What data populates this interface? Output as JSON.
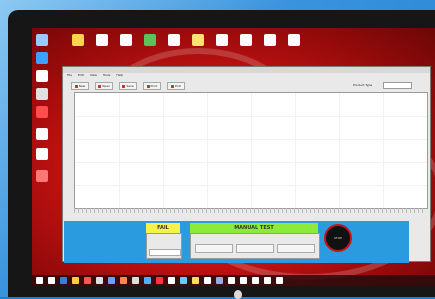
{
  "window": {
    "title": "",
    "menu": [
      "File",
      "Edit",
      "View",
      "Tools",
      "Help"
    ],
    "toolbar_buttons": [
      "New",
      "Open",
      "Save",
      "Print",
      "Exit"
    ],
    "product_label": "Product Type",
    "product_value": ""
  },
  "panel": {
    "status_text": "FAIL",
    "aux_label": "",
    "mode_title": "MANUAL TEST",
    "mode_buttons": [
      "",
      "",
      ""
    ],
    "emergency_label": "STOP"
  },
  "colors": {
    "status_yellow": "#f7f24a",
    "mode_green": "#8bea3a",
    "panel_blue": "#2b9be0",
    "wallpaper_red": "#d31515"
  }
}
